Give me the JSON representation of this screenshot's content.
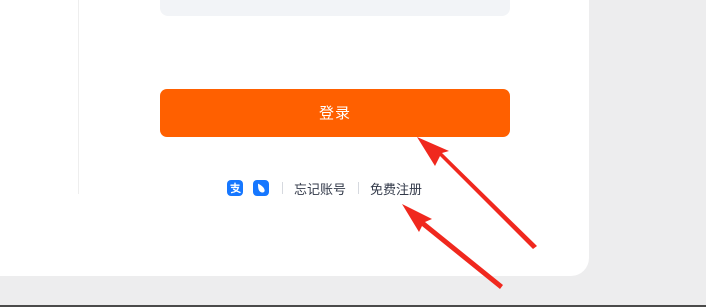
{
  "login": {
    "button_label": "登录"
  },
  "links": {
    "forgot_account": "忘记账号",
    "register": "免费注册"
  },
  "icons": {
    "alipay": "alipay-icon",
    "app": "app-icon"
  },
  "colors": {
    "accent": "#ff6000",
    "annotation_arrow": "#f0281e",
    "icon_blue": "#1677ff"
  }
}
